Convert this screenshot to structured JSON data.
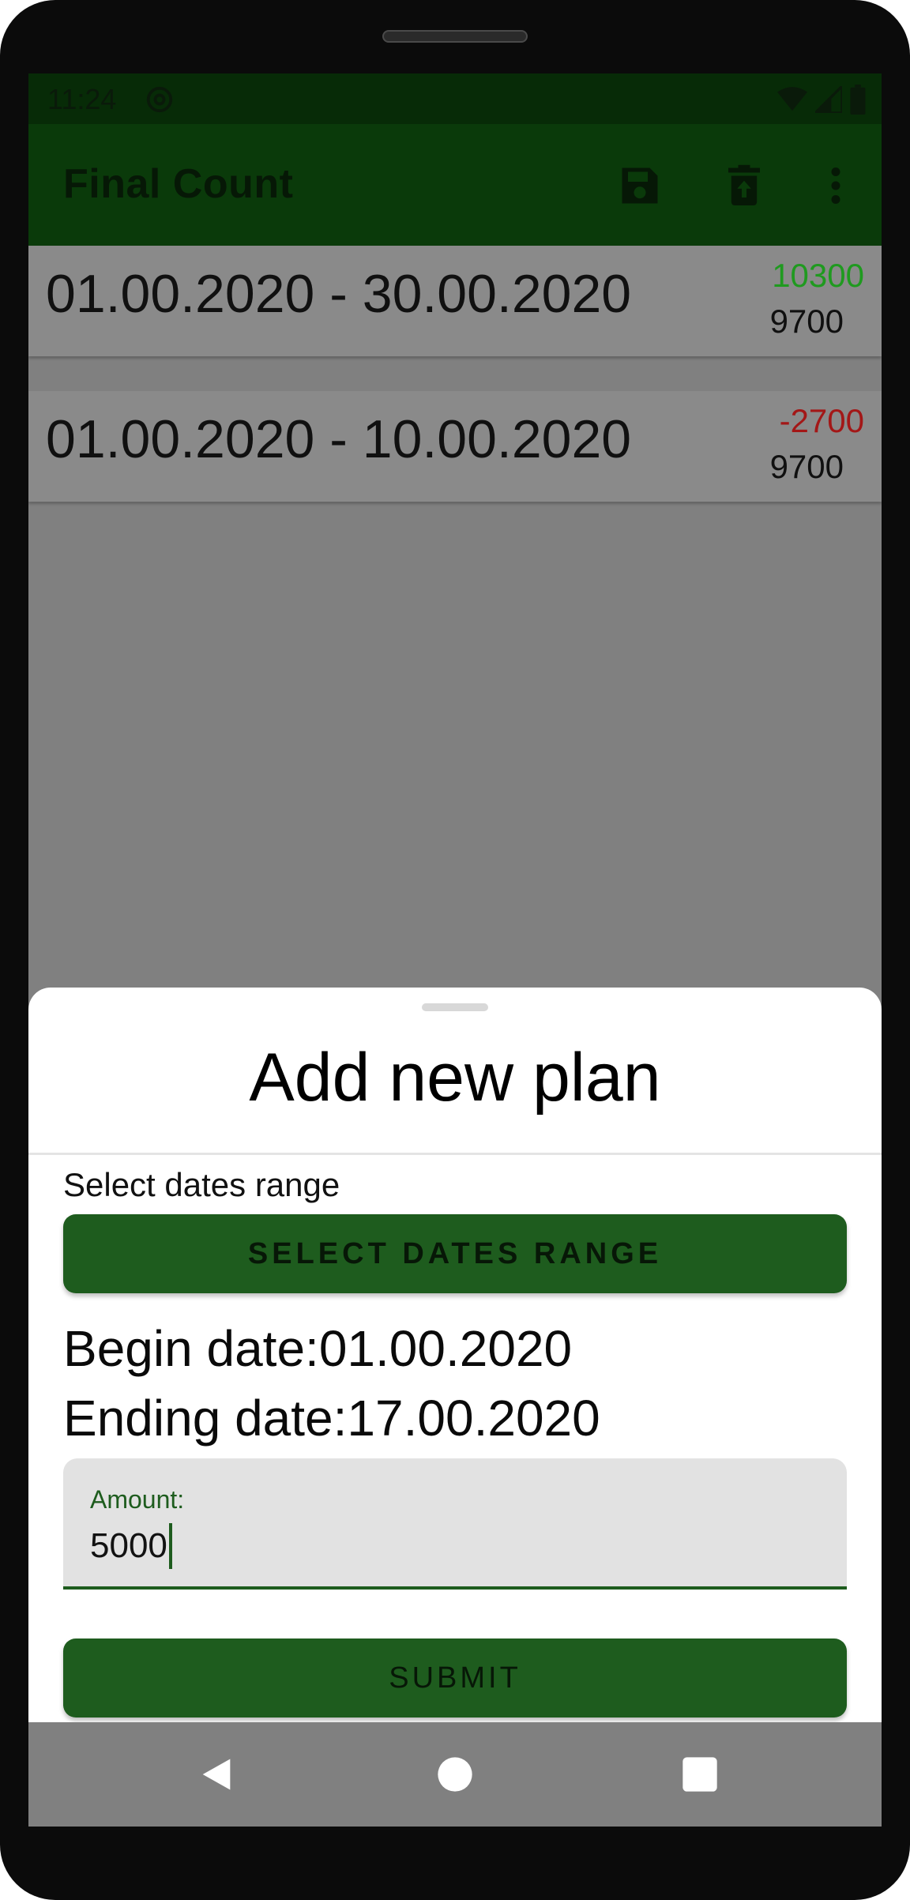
{
  "status_bar": {
    "time": "11:24",
    "icons": [
      "sync-icon",
      "wifi-icon",
      "signal-icon",
      "battery-icon"
    ]
  },
  "app_bar": {
    "title": "Final Count",
    "actions": [
      "save-icon",
      "delete-icon",
      "more-vert-icon"
    ]
  },
  "plans": [
    {
      "dates": "01.00.2020 - 30.00.2020",
      "balance": "10300",
      "balance_color": "#1f9a1f",
      "total": "9700"
    },
    {
      "dates": "01.00.2020 - 10.00.2020",
      "balance": "-2700",
      "balance_color": "#a31717",
      "total": "9700"
    }
  ],
  "sheet": {
    "title": "Add new plan",
    "range_label": "Select dates range",
    "range_button": "SELECT DATES RANGE",
    "begin_date": "Begin date:01.00.2020",
    "ending_date": "Ending date:17.00.2020",
    "amount_label": "Amount:",
    "amount_value": "5000",
    "submit_button": "SUBMIT"
  },
  "nav_bar": {
    "buttons": [
      "back-icon",
      "home-icon",
      "recents-icon"
    ]
  },
  "colors": {
    "accent": "#1e5c1e",
    "app_bar": "#0a3a0a",
    "scrim": "#808080"
  }
}
